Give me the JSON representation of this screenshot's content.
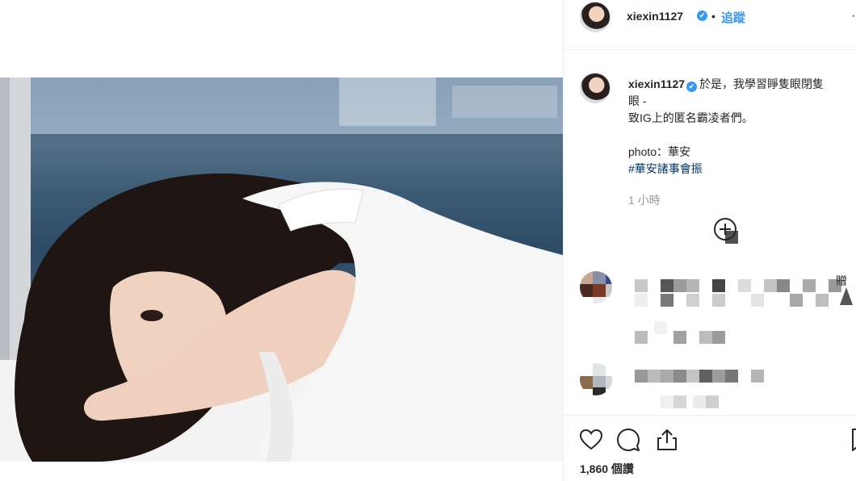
{
  "post": {
    "username": "xiexin1127",
    "verified_mark": "✔",
    "separator": "•",
    "follow_label": "追蹤",
    "more_label": "·"
  },
  "caption": {
    "username": "xiexin1127",
    "line1": "於是，我學習睜隻眼閉隻",
    "line2": "眼 -",
    "line3": "致IG上的匿名霸凌者們。",
    "line4": "photo：華安",
    "hashtag": "#華安諸事會振"
  },
  "timestamp": "1 小時",
  "comments_partial_label": "贈",
  "likes_text": "1,860 個讚",
  "icons": {
    "like": "heart-icon",
    "comment": "comment-icon",
    "share": "share-icon",
    "save": "bookmark-icon",
    "load_more": "plus-circle-icon"
  },
  "colors": {
    "link_blue": "#3897f0",
    "hashtag_blue": "#003569",
    "muted": "#999999",
    "text": "#262626",
    "border": "#efefef"
  }
}
